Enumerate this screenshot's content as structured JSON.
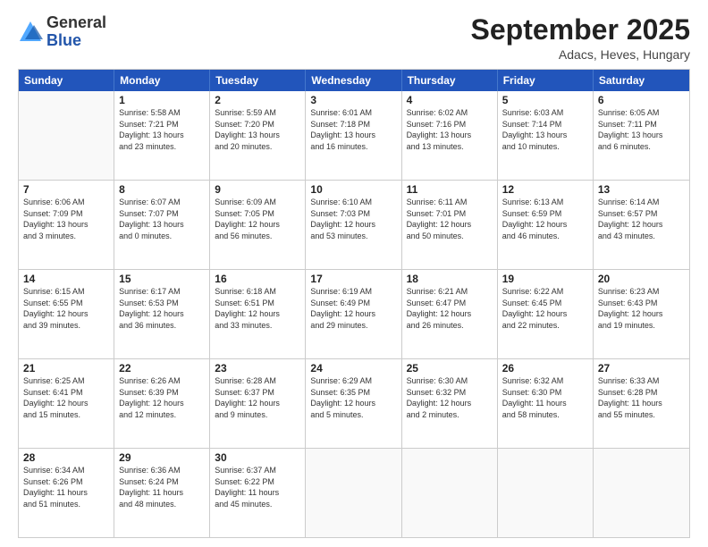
{
  "header": {
    "logo_general": "General",
    "logo_blue": "Blue",
    "month": "September 2025",
    "location": "Adacs, Heves, Hungary"
  },
  "weekdays": [
    "Sunday",
    "Monday",
    "Tuesday",
    "Wednesday",
    "Thursday",
    "Friday",
    "Saturday"
  ],
  "rows": [
    [
      {
        "day": "",
        "info": ""
      },
      {
        "day": "1",
        "info": "Sunrise: 5:58 AM\nSunset: 7:21 PM\nDaylight: 13 hours\nand 23 minutes."
      },
      {
        "day": "2",
        "info": "Sunrise: 5:59 AM\nSunset: 7:20 PM\nDaylight: 13 hours\nand 20 minutes."
      },
      {
        "day": "3",
        "info": "Sunrise: 6:01 AM\nSunset: 7:18 PM\nDaylight: 13 hours\nand 16 minutes."
      },
      {
        "day": "4",
        "info": "Sunrise: 6:02 AM\nSunset: 7:16 PM\nDaylight: 13 hours\nand 13 minutes."
      },
      {
        "day": "5",
        "info": "Sunrise: 6:03 AM\nSunset: 7:14 PM\nDaylight: 13 hours\nand 10 minutes."
      },
      {
        "day": "6",
        "info": "Sunrise: 6:05 AM\nSunset: 7:11 PM\nDaylight: 13 hours\nand 6 minutes."
      }
    ],
    [
      {
        "day": "7",
        "info": "Sunrise: 6:06 AM\nSunset: 7:09 PM\nDaylight: 13 hours\nand 3 minutes."
      },
      {
        "day": "8",
        "info": "Sunrise: 6:07 AM\nSunset: 7:07 PM\nDaylight: 13 hours\nand 0 minutes."
      },
      {
        "day": "9",
        "info": "Sunrise: 6:09 AM\nSunset: 7:05 PM\nDaylight: 12 hours\nand 56 minutes."
      },
      {
        "day": "10",
        "info": "Sunrise: 6:10 AM\nSunset: 7:03 PM\nDaylight: 12 hours\nand 53 minutes."
      },
      {
        "day": "11",
        "info": "Sunrise: 6:11 AM\nSunset: 7:01 PM\nDaylight: 12 hours\nand 50 minutes."
      },
      {
        "day": "12",
        "info": "Sunrise: 6:13 AM\nSunset: 6:59 PM\nDaylight: 12 hours\nand 46 minutes."
      },
      {
        "day": "13",
        "info": "Sunrise: 6:14 AM\nSunset: 6:57 PM\nDaylight: 12 hours\nand 43 minutes."
      }
    ],
    [
      {
        "day": "14",
        "info": "Sunrise: 6:15 AM\nSunset: 6:55 PM\nDaylight: 12 hours\nand 39 minutes."
      },
      {
        "day": "15",
        "info": "Sunrise: 6:17 AM\nSunset: 6:53 PM\nDaylight: 12 hours\nand 36 minutes."
      },
      {
        "day": "16",
        "info": "Sunrise: 6:18 AM\nSunset: 6:51 PM\nDaylight: 12 hours\nand 33 minutes."
      },
      {
        "day": "17",
        "info": "Sunrise: 6:19 AM\nSunset: 6:49 PM\nDaylight: 12 hours\nand 29 minutes."
      },
      {
        "day": "18",
        "info": "Sunrise: 6:21 AM\nSunset: 6:47 PM\nDaylight: 12 hours\nand 26 minutes."
      },
      {
        "day": "19",
        "info": "Sunrise: 6:22 AM\nSunset: 6:45 PM\nDaylight: 12 hours\nand 22 minutes."
      },
      {
        "day": "20",
        "info": "Sunrise: 6:23 AM\nSunset: 6:43 PM\nDaylight: 12 hours\nand 19 minutes."
      }
    ],
    [
      {
        "day": "21",
        "info": "Sunrise: 6:25 AM\nSunset: 6:41 PM\nDaylight: 12 hours\nand 15 minutes."
      },
      {
        "day": "22",
        "info": "Sunrise: 6:26 AM\nSunset: 6:39 PM\nDaylight: 12 hours\nand 12 minutes."
      },
      {
        "day": "23",
        "info": "Sunrise: 6:28 AM\nSunset: 6:37 PM\nDaylight: 12 hours\nand 9 minutes."
      },
      {
        "day": "24",
        "info": "Sunrise: 6:29 AM\nSunset: 6:35 PM\nDaylight: 12 hours\nand 5 minutes."
      },
      {
        "day": "25",
        "info": "Sunrise: 6:30 AM\nSunset: 6:32 PM\nDaylight: 12 hours\nand 2 minutes."
      },
      {
        "day": "26",
        "info": "Sunrise: 6:32 AM\nSunset: 6:30 PM\nDaylight: 11 hours\nand 58 minutes."
      },
      {
        "day": "27",
        "info": "Sunrise: 6:33 AM\nSunset: 6:28 PM\nDaylight: 11 hours\nand 55 minutes."
      }
    ],
    [
      {
        "day": "28",
        "info": "Sunrise: 6:34 AM\nSunset: 6:26 PM\nDaylight: 11 hours\nand 51 minutes."
      },
      {
        "day": "29",
        "info": "Sunrise: 6:36 AM\nSunset: 6:24 PM\nDaylight: 11 hours\nand 48 minutes."
      },
      {
        "day": "30",
        "info": "Sunrise: 6:37 AM\nSunset: 6:22 PM\nDaylight: 11 hours\nand 45 minutes."
      },
      {
        "day": "",
        "info": ""
      },
      {
        "day": "",
        "info": ""
      },
      {
        "day": "",
        "info": ""
      },
      {
        "day": "",
        "info": ""
      }
    ]
  ]
}
